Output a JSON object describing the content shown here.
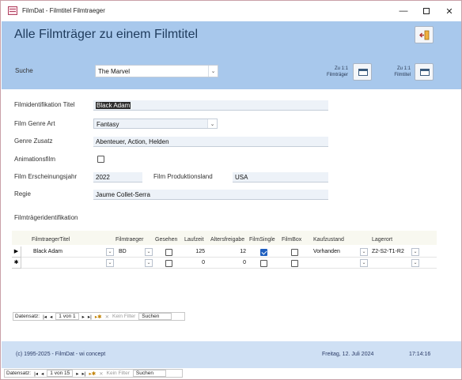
{
  "window": {
    "title": "FilmDat - Filmtitel Filmtraeger",
    "minimize_icon": "minimize-icon",
    "maximize_icon": "maximize-icon",
    "close_icon": "close-icon"
  },
  "header": {
    "title": "Alle Filmträger zu einem Filmtitel",
    "search_label": "Suche",
    "search_value": "The Marvel",
    "nav_traeger_label": "Zu 1:1 Filmträger",
    "nav_titel_label": "Zu 1:1 Filmtitel"
  },
  "form": {
    "titel_label": "Filmidentifikation Titel",
    "titel_value": "Black Adam",
    "genre_label": "Film Genre Art",
    "genre_value": "Fantasy",
    "zusatz_label": "Genre Zusatz",
    "zusatz_value": "Abenteuer, Action, Helden",
    "animation_label": "Animationsfilm",
    "animation_checked": false,
    "jahr_label": "Film Erscheinungsjahr",
    "jahr_value": "2022",
    "land_label": "Film Produktionsland",
    "land_value": "USA",
    "regie_label": "Regie",
    "regie_value": "Jaume Collet-Serra",
    "traeger_section_label": "Filmträgeridentifikation"
  },
  "subform": {
    "columns": [
      "FilmtraegerTitel",
      "Filmtraeger",
      "Gesehen",
      "Laufzeit",
      "Altersfreigabe",
      "FilmSingle",
      "FilmBox",
      "Kaufzustand",
      "Lagerort"
    ],
    "rows": [
      {
        "selector": "▶",
        "titel": "Black Adam",
        "traeger": "BD",
        "gesehen": false,
        "laufzeit": "125",
        "alter": "12",
        "single": true,
        "box": false,
        "kauf": "Vorhanden",
        "lager": "Z2-S2-T1-R2"
      },
      {
        "selector": "✱",
        "titel": "",
        "traeger": "",
        "gesehen": false,
        "laufzeit": "0",
        "alter": "0",
        "single": false,
        "box": false,
        "kauf": "",
        "lager": ""
      }
    ],
    "nav": {
      "label": "Datensatz:",
      "position": "1 von 1",
      "filter": "Kein Filter",
      "search": "Suchen"
    }
  },
  "footer": {
    "copyright": "(c) 1995-2025 - FilmDat - wi concept",
    "date": "Freitag, 12. Juli 2024",
    "time": "17:14:16"
  },
  "main_nav": {
    "label": "Datensatz:",
    "position": "1 von 15",
    "filter": "Kein Filter",
    "search": "Suchen"
  }
}
